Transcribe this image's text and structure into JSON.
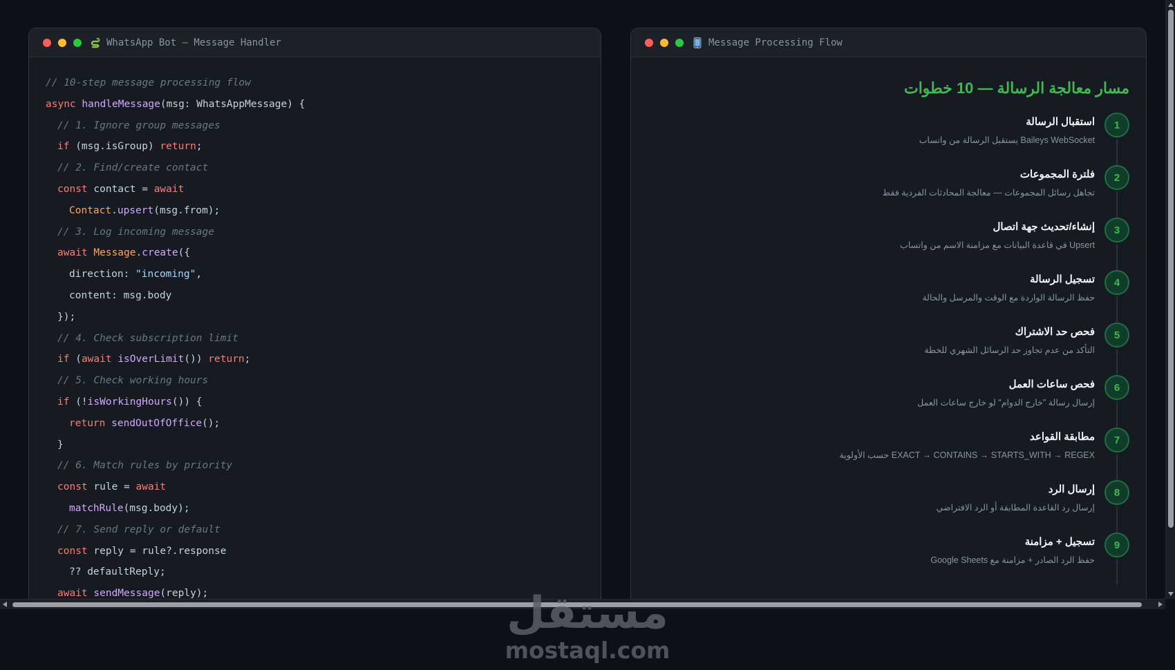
{
  "code_window": {
    "title": "WhatsApp Bot — Message Handler",
    "icon": "snake-icon",
    "lines": [
      "// 10-step message processing flow",
      "async",
      "handleMessage",
      "(msg: WhatsAppMessage) {",
      "// 1. Ignore group messages",
      "if",
      " (msg.isGroup) ",
      "return",
      ";",
      "// 2. Find/create contact",
      "const",
      " contact = ",
      "await",
      "Contact",
      ".",
      "upsert",
      "(msg.from);",
      "// 3. Log incoming message",
      "await",
      " ",
      "Message",
      ".",
      "create",
      "({",
      "direction: ",
      "\"incoming\"",
      ",",
      "content: msg.body",
      "});",
      "// 4. Check subscription limit",
      "if",
      " (",
      "await",
      " ",
      "isOverLimit",
      "()) ",
      "return",
      ";",
      "// 5. Check working hours",
      "if",
      " (!",
      "isWorkingHours",
      "()) {",
      "return",
      " ",
      "sendOutOfOffice",
      "();",
      "}",
      "// 6. Match rules by priority",
      "const",
      " rule = ",
      "await",
      "matchRule",
      "(msg.body);",
      "// 7. Send reply or default",
      "const",
      " reply = rule?.response",
      "?? defaultReply;",
      "await",
      " ",
      "sendMessage",
      "(reply);"
    ]
  },
  "flow_window": {
    "title": "Message Processing Flow",
    "icon": "mobile-phone-icon",
    "heading": "مسار معالجة الرسالة — 10 خطوات",
    "steps": [
      {
        "num": "1",
        "title": "استقبال الرسالة",
        "desc": "Baileys WebSocket يستقبل الرسالة من واتساب"
      },
      {
        "num": "2",
        "title": "فلترة المجموعات",
        "desc": "تجاهل رسائل المجموعات — معالجة المحادثات الفردية فقط"
      },
      {
        "num": "3",
        "title": "إنشاء/تحديث جهة اتصال",
        "desc": "Upsert في قاعدة البيانات مع مزامنة الاسم من واتساب"
      },
      {
        "num": "4",
        "title": "تسجيل الرسالة",
        "desc": "حفظ الرسالة الواردة مع الوقت والمرسل والحالة"
      },
      {
        "num": "5",
        "title": "فحص حد الاشتراك",
        "desc": "التأكد من عدم تجاوز حد الرسائل الشهري للخطة"
      },
      {
        "num": "6",
        "title": "فحص ساعات العمل",
        "desc": "إرسال رسالة \"خارج الدوام\" لو خارج ساعات العمل"
      },
      {
        "num": "7",
        "title": "مطابقة القواعد",
        "desc": "EXACT → CONTAINS → STARTS_WITH → REGEX حسب الأولوية"
      },
      {
        "num": "8",
        "title": "إرسال الرد",
        "desc": "إرسال رد القاعدة المطابقة أو الرد الافتراضي"
      },
      {
        "num": "9",
        "title": "تسجيل + مزامنة",
        "desc": "حفظ الرد الصادر + مزامنة مع Google Sheets"
      }
    ]
  },
  "watermark": {
    "arabic": "مستقل",
    "latin": "mostaql.com"
  },
  "colors": {
    "accent_green": "#3fb950",
    "keyword": "#ff7b72",
    "function": "#d2a8ff",
    "class": "#ffa657",
    "string": "#a5d6ff",
    "comment": "#6e7681"
  }
}
